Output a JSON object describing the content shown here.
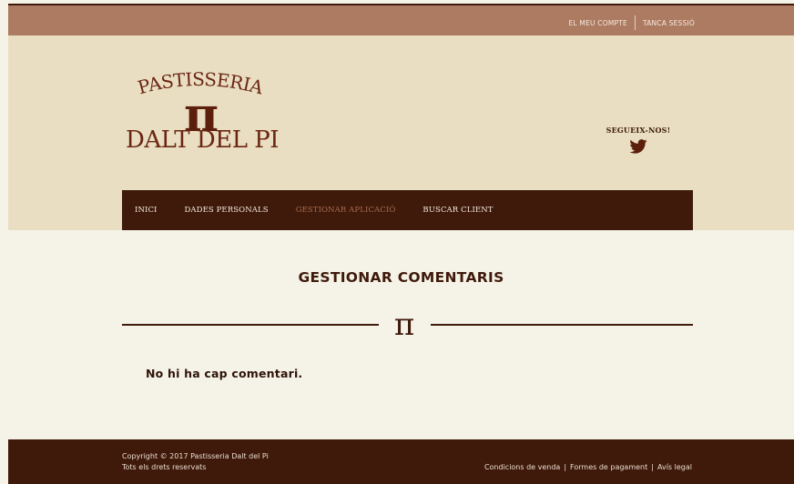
{
  "topbar": {
    "account_label": "EL MEU COMPTE",
    "logout_label": "TANCA SESSIÓ"
  },
  "logo": {
    "line1": "PASTISSERIA",
    "symbol": "π",
    "line2": "DALT DEL PI"
  },
  "social": {
    "follow_label": "SEGUEIX-NOS!",
    "icon": "twitter-icon"
  },
  "nav": {
    "items": [
      {
        "label": "INICI",
        "active": false
      },
      {
        "label": "DADES PERSONALS",
        "active": false
      },
      {
        "label": "GESTIONAR APLICACIÓ",
        "active": true
      },
      {
        "label": "BUSCAR CLIENT",
        "active": false
      }
    ]
  },
  "main": {
    "title": "GESTIONAR COMENTARIS",
    "divider_symbol": "π",
    "empty_message": "No hi ha cap comentari."
  },
  "footer": {
    "copyright": "Copyright © 2017 Pastisseria Dalt del Pi",
    "rights": "Tots els drets reservats",
    "links": [
      "Condicions de venda",
      "Formes de pagament",
      "Avís legal"
    ],
    "separator": "|"
  },
  "colors": {
    "topbar": "#ad7b61",
    "header": "#e9dec2",
    "dark_brown": "#3f1a0b",
    "content_bg": "#f5f3e8",
    "active_nav": "#a76c4e"
  }
}
